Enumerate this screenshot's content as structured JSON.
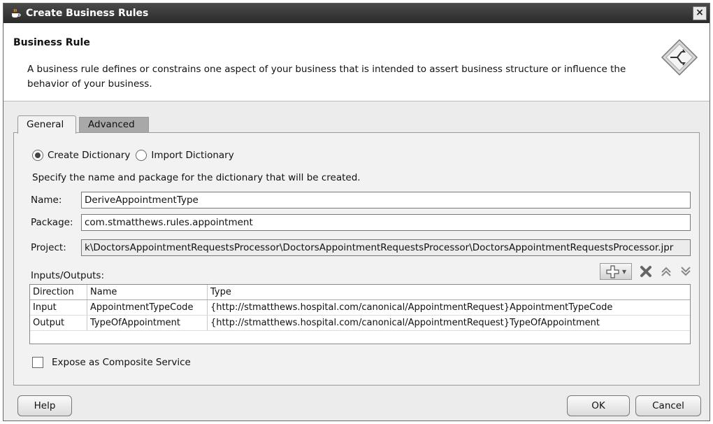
{
  "window": {
    "title": "Create Business Rules",
    "close_label": "×"
  },
  "header": {
    "title": "Business Rule",
    "description": "A business rule defines or constrains one aspect of your business that is intended to assert business structure or influence the behavior of your business."
  },
  "tabs": [
    {
      "label": "General",
      "selected": true
    },
    {
      "label": "Advanced",
      "selected": false
    }
  ],
  "dictionary_mode": {
    "create_label": "Create Dictionary",
    "import_label": "Import Dictionary",
    "selected": "create"
  },
  "instruction": "Specify the name and package for the dictionary that will be created.",
  "fields": {
    "name_label": "Name:",
    "name_value": "DeriveAppointmentType",
    "package_label": "Package:",
    "package_value": "com.stmatthews.rules.appointment",
    "project_label": "Project:",
    "project_value": "k\\DoctorsAppointmentRequestsProcessor\\DoctorsAppointmentRequestsProcessor\\DoctorsAppointmentRequestsProcessor.jpr"
  },
  "io": {
    "label": "Inputs/Outputs:",
    "columns": [
      "Direction",
      "Name",
      "Type"
    ],
    "rows": [
      [
        "Input",
        "AppointmentTypeCode",
        "{http://stmatthews.hospital.com/canonical/AppointmentRequest}AppointmentTypeCode"
      ],
      [
        "Output",
        "TypeOfAppointment",
        "{http://stmatthews.hospital.com/canonical/AppointmentRequest}TypeOfAppointment"
      ]
    ]
  },
  "expose_label": "Expose as Composite Service",
  "buttons": {
    "help": "Help",
    "ok": "OK",
    "cancel": "Cancel"
  },
  "icons": {
    "app": "java-cup-icon",
    "header": "business-rule-diamond-icon",
    "add": "add-icon",
    "delete": "delete-icon",
    "up": "move-up-icon",
    "down": "move-down-icon"
  }
}
